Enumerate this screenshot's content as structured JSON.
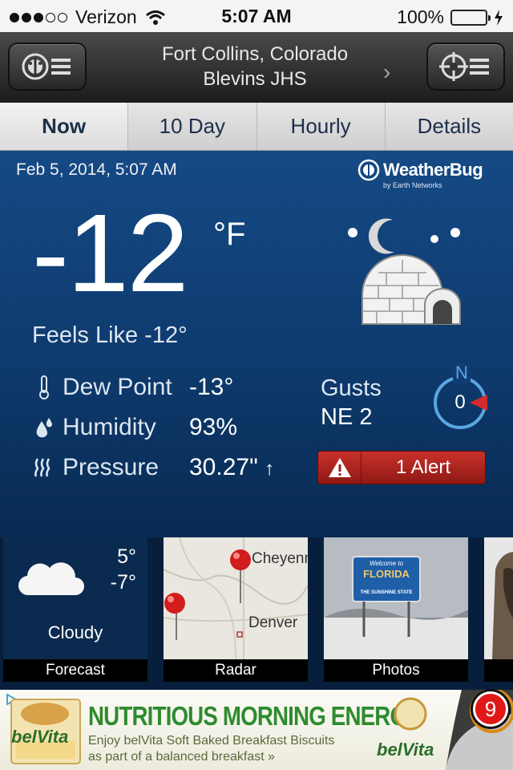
{
  "status_bar": {
    "carrier": "Verizon",
    "time": "5:07 AM",
    "battery": "100%",
    "signal_bars": 3,
    "signal_total": 5
  },
  "header": {
    "location_city": "Fort Collins, Colorado",
    "location_station": "Blevins JHS",
    "left_button_icon": "weatherbug-menu-icon",
    "right_button_icon": "location-target-icon"
  },
  "tabs": [
    {
      "label": "Now",
      "active": true
    },
    {
      "label": "10 Day",
      "active": false
    },
    {
      "label": "Hourly",
      "active": false
    },
    {
      "label": "Details",
      "active": false
    }
  ],
  "current": {
    "date": "Feb 5, 2014, 5:07 AM",
    "brand": "WeatherBug",
    "brand_sub": "by Earth Networks",
    "temperature": "-12",
    "unit": "°F",
    "feels_like_label": "Feels Like",
    "feels_like_value": "-12°",
    "condition_icon": "igloo-night-icon",
    "dew_point_label": "Dew Point",
    "dew_point_value": "-13°",
    "humidity_label": "Humidity",
    "humidity_value": "93%",
    "pressure_label": "Pressure",
    "pressure_value": "30.27\"",
    "pressure_trend": "↑",
    "gusts_label": "Gusts",
    "gusts_value": "NE 2",
    "compass_dir": "N",
    "compass_value": "0",
    "alert_text": "1 Alert"
  },
  "tiles": [
    {
      "caption": "Forecast",
      "high": "5°",
      "low": "-7°",
      "condition": "Cloudy"
    },
    {
      "caption": "Radar",
      "map_labels": [
        "Cheyenn",
        "Denver"
      ]
    },
    {
      "caption": "Photos",
      "sign_text": "FLORIDA",
      "sign_top": "Welcome to",
      "sign_bottom": "THE SUNSHINE STATE"
    }
  ],
  "ad": {
    "headline": "NUTRITIOUS MORNING ENERGY",
    "line1": "Enjoy belVita Soft Baked Breakfast Biscuits",
    "line2": "as part of a balanced breakfast »",
    "brand": "belVita",
    "badge_count": "9"
  },
  "colors": {
    "main_bg": "#0e3a6d",
    "alert_red": "#b22a24",
    "ad_green": "#2e8b2e",
    "compass_blue": "#5aa6e0"
  }
}
